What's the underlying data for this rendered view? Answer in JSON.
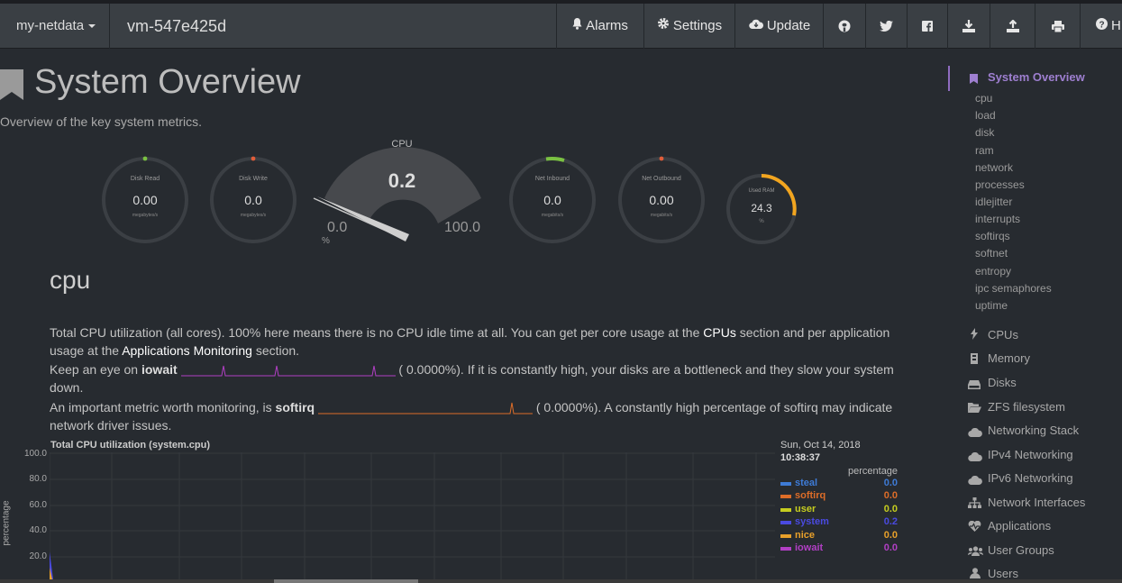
{
  "navbar": {
    "brand": "my-netdata",
    "hostname": "vm-547e425d",
    "alarms": "Alarms",
    "settings": "Settings",
    "update": "Update",
    "help": "H"
  },
  "page": {
    "title": "System Overview",
    "subtitle": "Overview of the key system metrics."
  },
  "gauges": {
    "disk_read": {
      "title": "Disk Read",
      "value": "0.00",
      "unit": "megabytes/s"
    },
    "disk_write": {
      "title": "Disk Write",
      "value": "0.0",
      "unit": "megabytes/s"
    },
    "cpu": {
      "title": "CPU",
      "value": "0.2",
      "min": "0.0",
      "max": "100.0",
      "unit": "%"
    },
    "net_inbound": {
      "title": "Net Inbound",
      "value": "0.0",
      "unit": "megabits/s"
    },
    "net_outbound": {
      "title": "Net Outbound",
      "value": "0.00",
      "unit": "megabits/s"
    },
    "used_ram": {
      "title": "Used RAM",
      "value": "24.3",
      "unit": "%",
      "fraction": 0.243
    }
  },
  "cpu_section": {
    "title": "cpu",
    "p1_a": "Total CPU utilization (all cores). 100% here means there is no CPU idle time at all. You can get per core usage at the ",
    "p1_link1": "CPUs",
    "p1_b": " section and per application usage at the ",
    "p1_link2": "Applications Monitoring",
    "p1_c": " section.",
    "p2_a": "Keep an eye on ",
    "p2_bold": "iowait",
    "p2_val": " ( 0.0000%). If it is constantly high, your disks are a bottleneck and they slow your system down.",
    "p3_a": "An important metric worth monitoring, is ",
    "p3_bold": "softirq",
    "p3_val": " ( 0.0000%). A constantly high percentage of softirq may indicate network driver issues."
  },
  "chart": {
    "title": "Total CPU utilization (system.cpu)",
    "ylabel": "percentage",
    "yticks": [
      "100.0",
      "80.0",
      "60.0",
      "40.0",
      "20.0"
    ],
    "date": "Sun, Oct 14, 2018",
    "time": "10:38:37",
    "legend_header": "percentage",
    "legend": [
      {
        "name": "steal",
        "value": "0.0",
        "color": "#3e7bd6"
      },
      {
        "name": "softirq",
        "value": "0.0",
        "color": "#dd6d28"
      },
      {
        "name": "user",
        "value": "0.0",
        "color": "#c6cd1f"
      },
      {
        "name": "system",
        "value": "0.2",
        "color": "#4a4ae0"
      },
      {
        "name": "nice",
        "value": "0.0",
        "color": "#e8a02a"
      },
      {
        "name": "iowait",
        "value": "0.0",
        "color": "#b13fc4"
      }
    ]
  },
  "sidebar": {
    "active": "System Overview",
    "subitems": [
      "cpu",
      "load",
      "disk",
      "ram",
      "network",
      "processes",
      "idlejitter",
      "interrupts",
      "softirqs",
      "softnet",
      "entropy",
      "ipc semaphores",
      "uptime"
    ],
    "items": [
      "CPUs",
      "Memory",
      "Disks",
      "ZFS filesystem",
      "Networking Stack",
      "IPv4 Networking",
      "IPv6 Networking",
      "Network Interfaces",
      "Applications",
      "User Groups",
      "Users"
    ]
  }
}
